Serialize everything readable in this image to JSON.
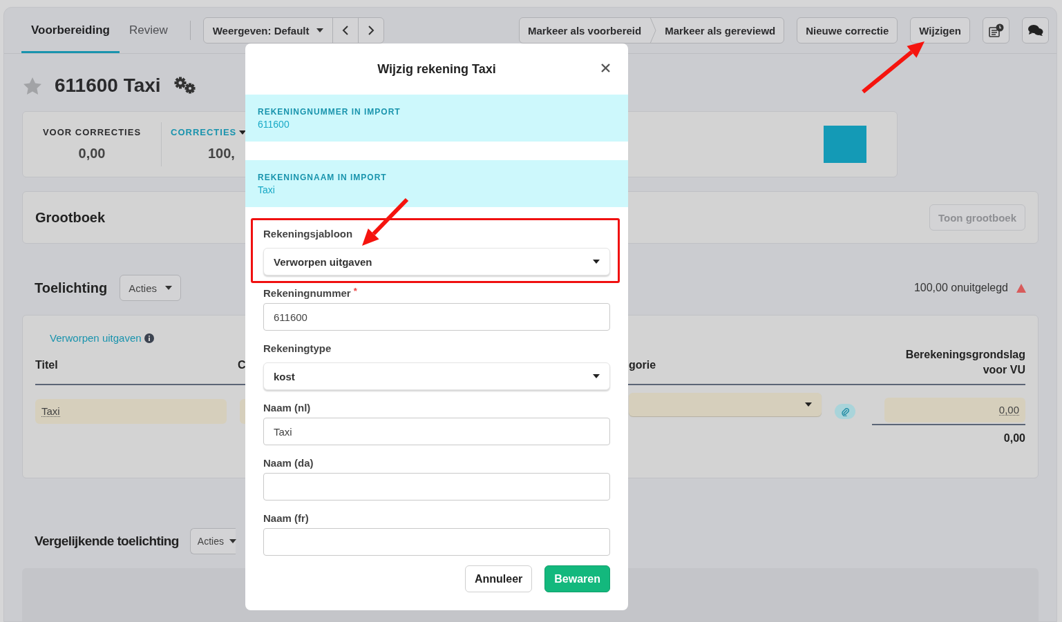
{
  "tabs": [
    {
      "label": "Voorbereiding",
      "selected": true
    },
    {
      "label": "Review",
      "selected": false
    }
  ],
  "view_select": {
    "label": "Weergeven: Default"
  },
  "status_buttons": [
    "Markeer als voorbereid",
    "Markeer als gereviewd"
  ],
  "toolbar_buttons": [
    "Nieuwe correctie",
    "Wijzigen"
  ],
  "account": {
    "title": "611600 Taxi",
    "starred": false
  },
  "summary": [
    {
      "label": "VOOR CORRECTIES",
      "value": "0,00",
      "kind": "plain"
    },
    {
      "label": "CORRECTIES",
      "value": "100,",
      "kind": "dropdown"
    }
  ],
  "ledger": {
    "title": "Grootboek",
    "button": {
      "label": "Toon grootboek",
      "disabled": true
    }
  },
  "explanation": {
    "title": "Toelichting",
    "actions": "Acties",
    "status": "100,00 onuitgelegd",
    "warning": true,
    "template_link": "Verworpen uitgaven",
    "columns": [
      "Titel",
      "C",
      "gorie",
      "Berekeningsgrondslag voor VU"
    ],
    "rows": [
      {
        "title": "Taxi",
        "amount": "0,00"
      }
    ],
    "total": "0,00"
  },
  "comparative": {
    "title": "Vergelijkende toelichting",
    "actions": "Acties"
  },
  "modal": {
    "title": "Wijzig rekening Taxi",
    "import_info": [
      {
        "label": "REKENINGNUMMER IN IMPORT",
        "value": "611600"
      },
      {
        "label": "REKENINGNAAM IN IMPORT",
        "value": "Taxi"
      }
    ],
    "fields": [
      {
        "kind": "select",
        "label": "Rekeningsjabloon",
        "value": "Verworpen uitgaven",
        "highlighted": true
      },
      {
        "kind": "text",
        "label": "Rekeningnummer",
        "required_mark": "*",
        "value": "611600",
        "highlighted": false
      },
      {
        "kind": "select",
        "label": "Rekeningtype",
        "value": "kost",
        "highlighted": false
      },
      {
        "kind": "text",
        "label": "Naam (nl)",
        "value": "Taxi",
        "highlighted": false
      },
      {
        "kind": "text",
        "label": "Naam (da)",
        "highlighted": false
      },
      {
        "kind": "text",
        "label": "Naam (fr)",
        "highlighted": false
      }
    ],
    "buttons": [
      {
        "label": "Annuleer",
        "kind": "secondary"
      },
      {
        "label": "Bewaren",
        "kind": "primary"
      }
    ]
  }
}
